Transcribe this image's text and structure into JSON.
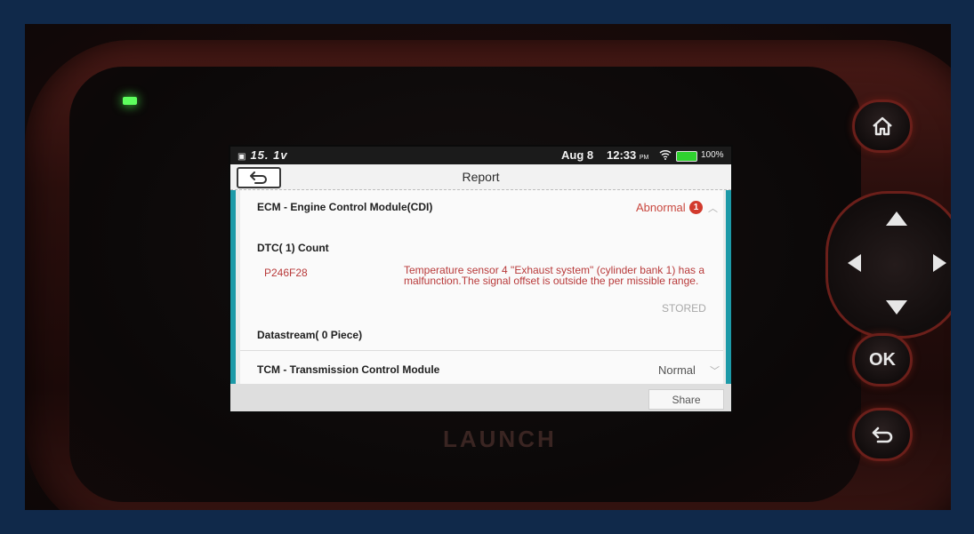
{
  "device": {
    "brand": "LAUNCH",
    "buttons": {
      "ok": "OK"
    }
  },
  "statusbar": {
    "left_text": "15. 1v",
    "date": "Aug 8",
    "time": "12:33",
    "ampm": "PM",
    "battery": "100%"
  },
  "header": {
    "title": "Report"
  },
  "report": {
    "ecm": {
      "name": "ECM - Engine Control Module(CDI)",
      "status": "Abnormal",
      "badge": "1",
      "dtc_label": "DTC( 1) Count",
      "dtc": {
        "code": "P246F28",
        "description": "Temperature sensor 4 \"Exhaust system\" (cylinder bank 1) has a malfunction.The signal offset is outside the per missible range.",
        "state": "STORED"
      },
      "datastream_label": "Datastream( 0 Piece)"
    },
    "tcm": {
      "name": "TCM - Transmission Control Module",
      "status": "Normal"
    }
  },
  "footer": {
    "share_label": "Share"
  },
  "colors": {
    "accent_teal": "#1d9aa8",
    "abnormal_red": "#c9483f",
    "led_green": "#5dff5d"
  }
}
